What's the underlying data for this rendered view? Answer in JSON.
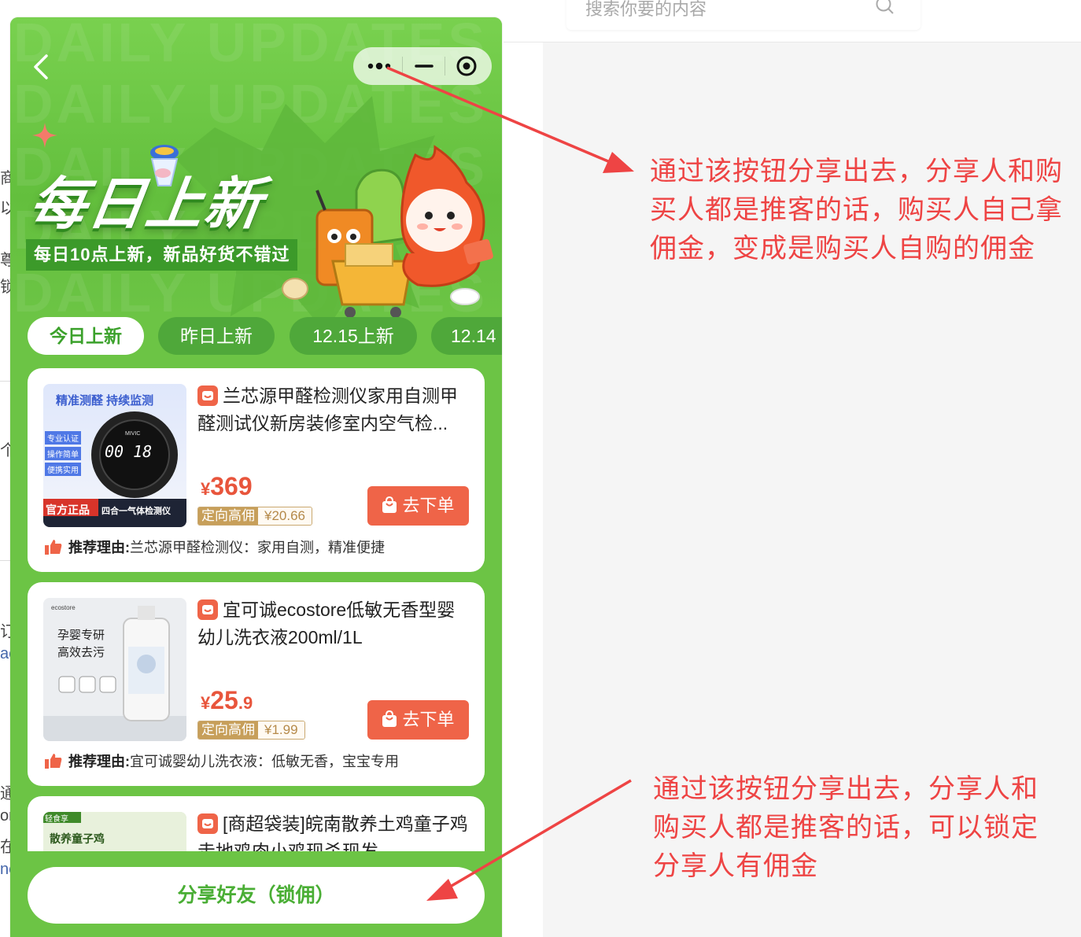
{
  "background": {
    "search_placeholder": "搜索你要的内容",
    "edge_chars": [
      "商",
      "以",
      "尊",
      "锁",
      "个",
      "订",
      "ac",
      "通",
      "or",
      "在",
      "nc"
    ]
  },
  "nav": {
    "back_icon": "chevron-left-icon",
    "capsule_icons": [
      "more-dots-icon",
      "minimize-icon",
      "close-target-icon"
    ]
  },
  "hero": {
    "watermark": "DAILY UPDATES",
    "title": "每日上新",
    "subtitle": "每日10点上新，新品好货不错过"
  },
  "tabs": [
    {
      "label": "今日上新",
      "active": true
    },
    {
      "label": "昨日上新",
      "active": false
    },
    {
      "label": "12.15上新",
      "active": false
    },
    {
      "label": "12.14",
      "active": false
    }
  ],
  "products": [
    {
      "title": "兰芯源甲醛检测仪家用自测甲醛测试仪新房装修室内空气检...",
      "thumb": {
        "headline": "精准测醛 持续监测",
        "badges": [
          "专业认证",
          "操作简单",
          "便携实用"
        ],
        "screen": "00 18",
        "brand": "MIVIC",
        "footer_tag": "官方正品",
        "footer_text": "四合一气体检测仪"
      },
      "price_int": "369",
      "price_dec": "",
      "price_symbol": "¥",
      "commission_label": "定向高佣",
      "commission_value": "¥20.66",
      "buy_label": "去下单",
      "reason_label": "推荐理由:",
      "reason_text": "兰芯源甲醛检测仪：家用自测，精准便捷"
    },
    {
      "title": "宜可诚ecostore低敏无香型婴幼儿洗衣液200ml/1L",
      "thumb": {
        "brand": "ecostore",
        "headline_1": "孕婴专研",
        "headline_2": "高效去污"
      },
      "price_int": "25",
      "price_dec": ".9",
      "price_symbol": "¥",
      "commission_label": "定向高佣",
      "commission_value": "¥1.99",
      "buy_label": "去下单",
      "reason_label": "推荐理由:",
      "reason_text": "宜可诚婴幼儿洗衣液：低敏无香，宝宝专用"
    },
    {
      "title": "[商超袋装]皖南散养土鸡童子鸡走地鸡肉小鸡现杀现发",
      "thumb": {
        "tag": "轻食享",
        "headline": "散养童子鸡"
      }
    }
  ],
  "share_button": "分享好友（锁佣）",
  "annotations": {
    "top": [
      "通过该按钮分享出去，分享人和购",
      "买人都是推客的话，购买人自己拿",
      "佣金，变成是购买人自购的佣金"
    ],
    "bottom": [
      "通过该按钮分享出去，分享人和",
      "购买人都是推客的话，可以锁定",
      "分享人有佣金"
    ]
  },
  "colors": {
    "theme_green": "#6cc445",
    "button_orange": "#ef6448",
    "price_red": "#e8553c",
    "annotation_red": "#ee4444"
  }
}
